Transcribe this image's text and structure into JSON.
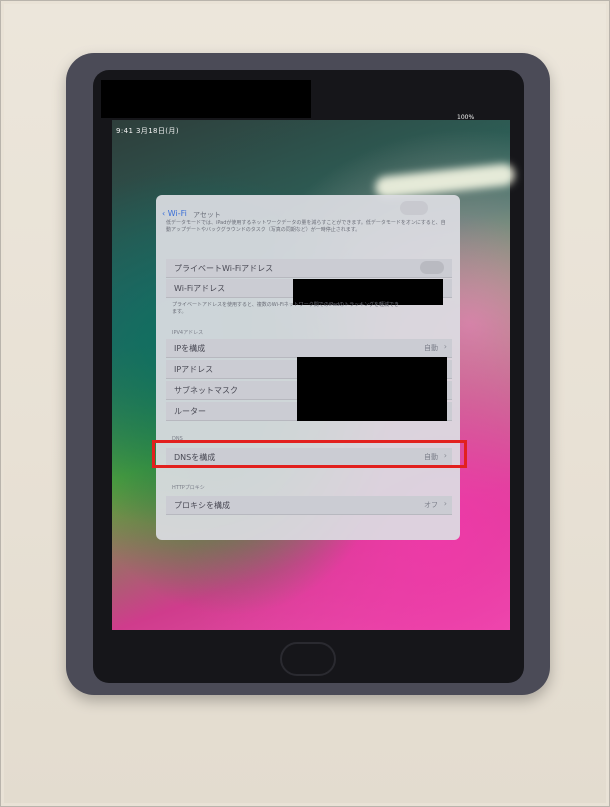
{
  "status_bar": {
    "time": "9:41 3月18日(月)",
    "battery": "100%"
  },
  "nav": {
    "back_label": "Wi-Fi",
    "title": "アセット"
  },
  "panel": {
    "description": "低データモードでは、iPadが使用するネットワークデータの量を減らすことができます。低データモードをオンにすると、自動アップデートやバックグラウンドのタスク（写真の同期など）が一時停止されます。",
    "private_address": {
      "label": "プライベートWi-Fiアドレス"
    },
    "wifi_address": {
      "label": "Wi-Fiアドレス"
    },
    "private_note": "プライベートアドレスを使用すると、複数のWi-Fiネットワーク間でのiPadのトラッキングを軽減できます。",
    "ipv4_header": "IPV4アドレス",
    "ip_config": {
      "label": "IPを構成",
      "value": "自動"
    },
    "ip_address": {
      "label": "IPアドレス"
    },
    "subnet": {
      "label": "サブネットマスク"
    },
    "router": {
      "label": "ルーター"
    },
    "dns_header": "DNS",
    "dns_config": {
      "label": "DNSを構成",
      "value": "自動"
    },
    "proxy_header": "HTTPプロキシ",
    "proxy_config": {
      "label": "プロキシを構成",
      "value": "オフ"
    }
  },
  "colors": {
    "highlight": "#e2201e",
    "case": "#4b4b57",
    "accent_tab": "#f06a22"
  }
}
